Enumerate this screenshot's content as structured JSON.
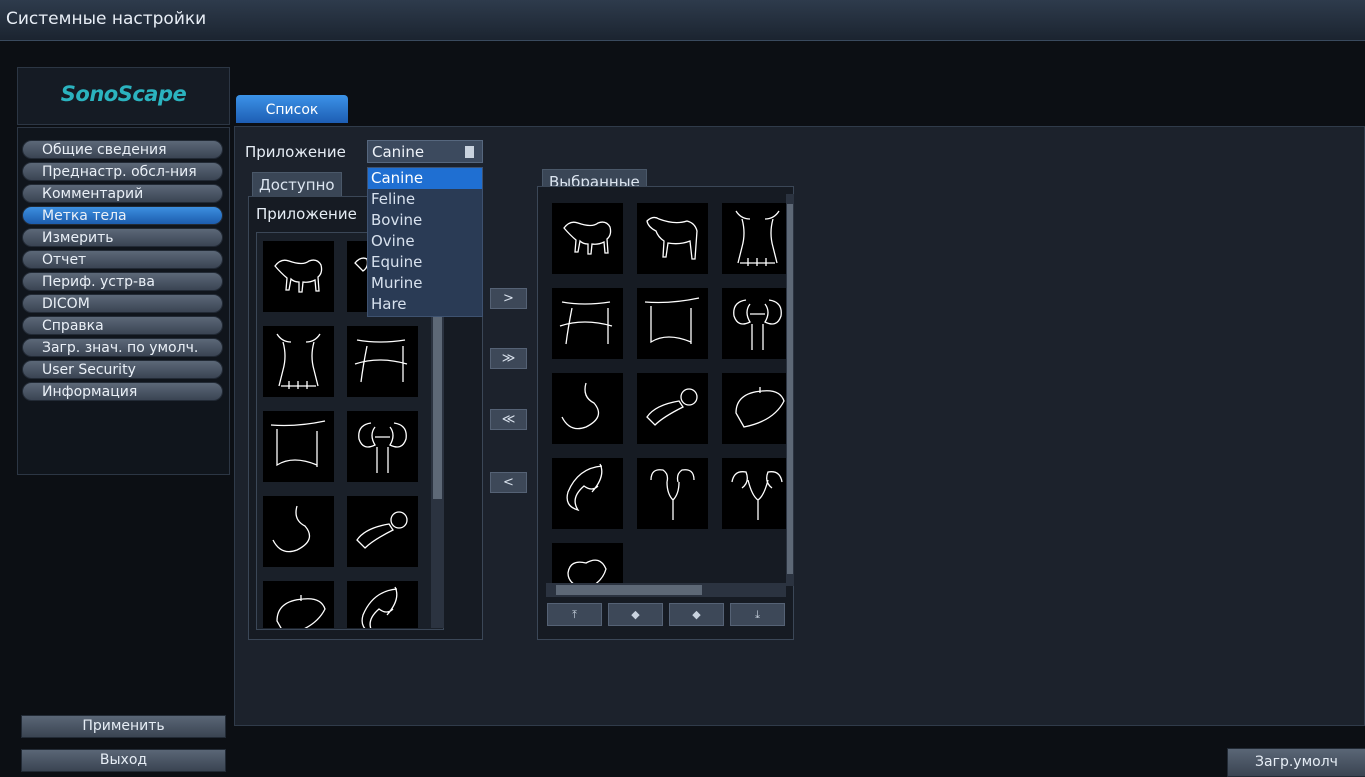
{
  "window": {
    "title": "Системные настройки"
  },
  "logo": {
    "text": "SonoScape"
  },
  "sidebar": {
    "items": [
      {
        "label": "Общие сведения"
      },
      {
        "label": "Преднастр. обсл-ния"
      },
      {
        "label": "Комментарий"
      },
      {
        "label": "Метка тела",
        "active": true
      },
      {
        "label": "Измерить"
      },
      {
        "label": "Отчет"
      },
      {
        "label": "Периф. устр-ва"
      },
      {
        "label": "DICOM"
      },
      {
        "label": "Справка"
      },
      {
        "label": "Загр. знач. по умолч."
      },
      {
        "label": "User Security"
      },
      {
        "label": "Информация"
      }
    ],
    "apply_label": "Применить",
    "exit_label": "Выход"
  },
  "tab": {
    "label": "Список"
  },
  "app_select": {
    "label": "Приложение",
    "value": "Canine",
    "options": [
      "Canine",
      "Feline",
      "Bovine",
      "Ovine",
      "Equine",
      "Murine",
      "Hare"
    ]
  },
  "available": {
    "tab_label": "Доступно",
    "sub_label": "Приложение",
    "icons": [
      "dog-icon",
      "dog-icon",
      "thorax-icon",
      "abdomen-side-icon",
      "abdomen-front-icon",
      "kidney-icon",
      "stomach-icon",
      "bladder-icon",
      "liver-icon",
      "intestine-icon"
    ]
  },
  "transfer": {
    "add": ">",
    "add_all": "≫",
    "remove_all": "≪",
    "remove": "<"
  },
  "selected": {
    "tab_label": "Выбранные",
    "icons": [
      "dog-icon",
      "dog-icon",
      "thorax-icon",
      "abdomen-side-icon",
      "abdomen-front-icon",
      "kidney-icon",
      "stomach-icon",
      "bladder-icon",
      "liver-icon",
      "intestine-icon",
      "uterus-icon",
      "uterus2-icon",
      "heart-icon"
    ],
    "move": {
      "top": "⤒",
      "left": "◆",
      "right": "◆",
      "bottom": "⤓"
    }
  },
  "footer": {
    "reset_label": "Загр.умолч"
  },
  "colors": {
    "accent": "#1f6fd2",
    "logo": "#2bb3bf",
    "background": "#0c0f14"
  }
}
